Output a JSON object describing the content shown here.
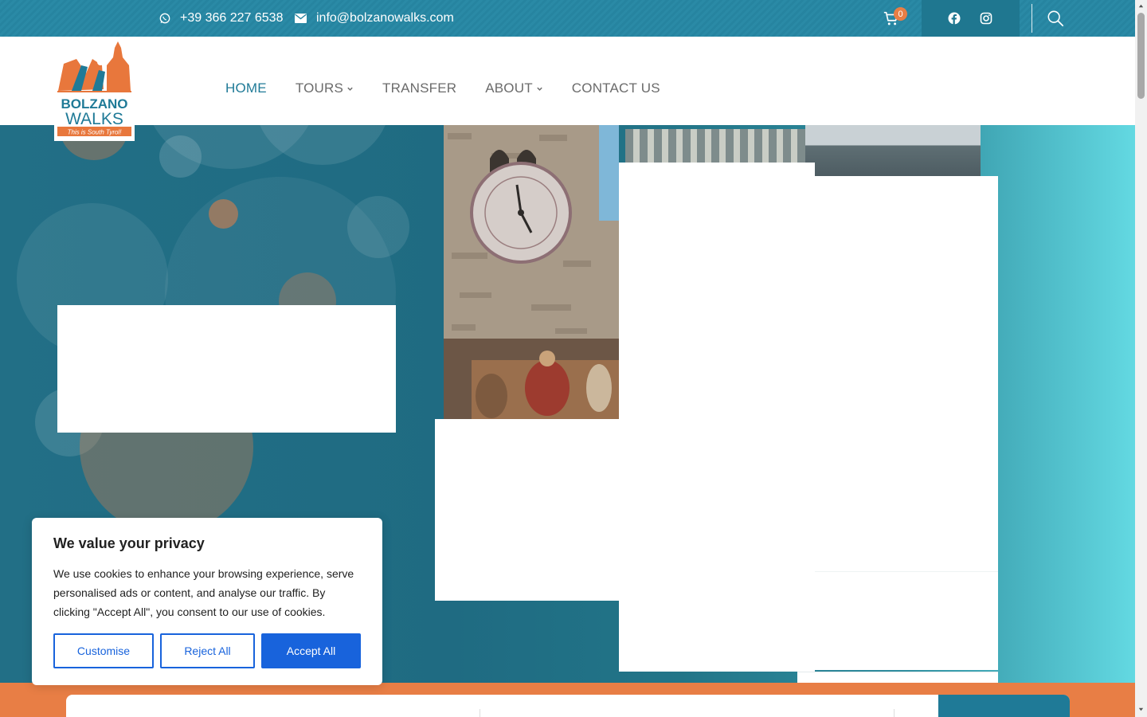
{
  "topbar": {
    "phone": "+39 366 227 6538",
    "email": "info@bolzanowalks.com",
    "cart_count": "0",
    "icons": [
      "whatsapp-icon",
      "envelope-icon",
      "cart-icon",
      "facebook-icon",
      "instagram-icon",
      "search-icon"
    ]
  },
  "logo": {
    "line1": "BOLZANO",
    "line2": "WALKS",
    "tagline": "This is South Tyrol!"
  },
  "nav": {
    "items": [
      {
        "label": "HOME",
        "active": true
      },
      {
        "label": "TOURS",
        "dropdown": true
      },
      {
        "label": "TRANSFER"
      },
      {
        "label": "ABOUT",
        "dropdown": true
      },
      {
        "label": "CONTACT US"
      }
    ]
  },
  "cookie": {
    "title": "We value your privacy",
    "text": "We use cookies to enhance your browsing experience, serve personalised ads or content, and analyse our traffic. By clicking \"Accept All\", you consent to our use of cookies.",
    "customise": "Customise",
    "reject": "Reject All",
    "accept": "Accept All"
  },
  "colors": {
    "teal": "#1f7a97",
    "orange": "#e87e45",
    "cookie_blue": "#1863dc"
  }
}
